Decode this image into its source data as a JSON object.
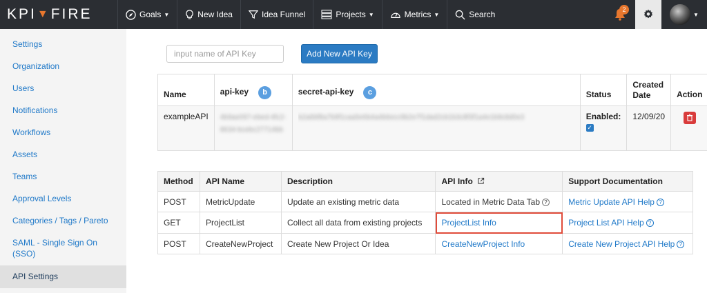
{
  "nav": {
    "logo_left": "KPI",
    "logo_right": "FIRE",
    "items": [
      {
        "label": "Goals",
        "icon": "compass-icon",
        "caret": true
      },
      {
        "label": "New Idea",
        "icon": "lightbulb-icon",
        "caret": false
      },
      {
        "label": "Idea Funnel",
        "icon": "funnel-icon",
        "caret": false
      },
      {
        "label": "Projects",
        "icon": "projects-icon",
        "caret": true
      },
      {
        "label": "Metrics",
        "icon": "gauge-icon",
        "caret": true
      },
      {
        "label": "Search",
        "icon": "search-icon",
        "caret": false
      }
    ],
    "notification_count": "2"
  },
  "sidebar": {
    "items": [
      {
        "label": "Settings"
      },
      {
        "label": "Organization"
      },
      {
        "label": "Users"
      },
      {
        "label": "Notifications"
      },
      {
        "label": "Workflows"
      },
      {
        "label": "Assets"
      },
      {
        "label": "Teams"
      },
      {
        "label": "Approval Levels"
      },
      {
        "label": "Categories / Tags / Pareto"
      },
      {
        "label": "SAML - Single Sign On (SSO)"
      },
      {
        "label": "API Settings",
        "active": true
      }
    ]
  },
  "api_key_form": {
    "placeholder": "input name of API Key",
    "button_label": "Add New API Key"
  },
  "keys_table": {
    "headers": {
      "name": "Name",
      "api_key": "api-key",
      "api_key_marker": "b",
      "secret": "secret-api-key",
      "secret_marker": "c",
      "status": "Status",
      "created": "Created Date",
      "action": "Action"
    },
    "row": {
      "name": "exampleAPI",
      "api_key_masked": "4b9ae097-ebed-4fc2-8634-bcebc27714bb",
      "secret_masked": "b2a6bf8a7b9f1caa5e6b4a4b6ecc9b2e7f1dad2cb1b3c8f3f1a4e1b9c8d0e3",
      "status": "Enabled:",
      "created": "12/09/20"
    }
  },
  "api_table": {
    "headers": [
      "Method",
      "API Name",
      "Description",
      "API Info",
      "Support Documentation"
    ],
    "rows": [
      {
        "method": "POST",
        "name": "MetricUpdate",
        "description": "Update an existing metric data",
        "info": "Located in Metric Data Tab",
        "info_is_link": false,
        "doc": "Metric Update API Help"
      },
      {
        "method": "GET",
        "name": "ProjectList",
        "description": "Collect all data from existing projects",
        "info": "ProjectList Info",
        "info_is_link": true,
        "doc": "Project List API Help",
        "highlighted": true
      },
      {
        "method": "POST",
        "name": "CreateNewProject",
        "description": "Create New Project Or Idea",
        "info": "CreateNewProject Info",
        "info_is_link": true,
        "doc": "Create New Project API Help"
      }
    ]
  },
  "colors": {
    "topbar": "#2b2e33",
    "link": "#1e78c8",
    "accent": "#e8772e",
    "button": "#2b7bc3",
    "highlight": "#e04b3a",
    "delete": "#d93b3b"
  }
}
